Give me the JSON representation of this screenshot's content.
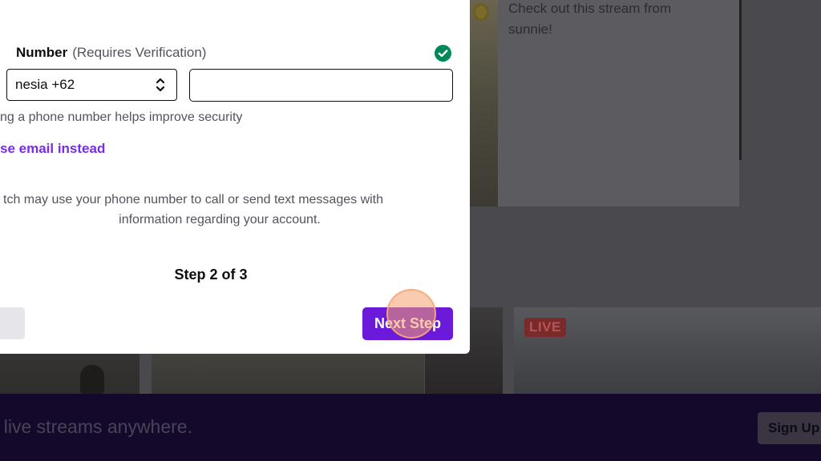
{
  "background": {
    "promo_text": "Check out this stream from sunnie!",
    "live_badge": "LIVE",
    "banner_text": "t live streams anywhere.",
    "signup_label": "Sign Up"
  },
  "modal": {
    "field_label": "Number",
    "field_hint": "(Requires Verification)",
    "verified_icon": "check-circle-icon",
    "country_value": "nesia +62",
    "phone_value": "",
    "help_text": "ng a phone number helps improve security",
    "alt_link": "se email instead",
    "disclaimer_line1": "tch may use your phone number to call or send text messages with",
    "disclaimer_line2": "information regarding your account.",
    "step_text": "Step 2 of 3",
    "next_label": "Next Step"
  },
  "colors": {
    "accent": "#6a1ad8",
    "link": "#772ce8",
    "verified": "#00875a",
    "banner": "#15092b",
    "click_highlight": "#f6a06e"
  }
}
